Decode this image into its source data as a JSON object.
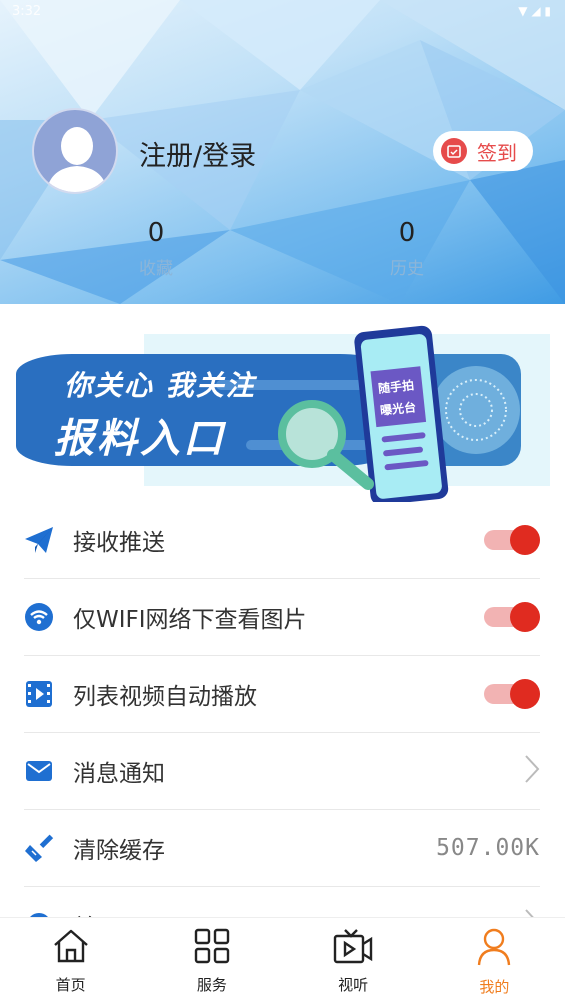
{
  "status_bar": {
    "time": "3:32",
    "battery": ""
  },
  "profile": {
    "login_label": "注册/登录",
    "signin_label": "签到",
    "stats": [
      {
        "value": "0",
        "label": "收藏"
      },
      {
        "value": "0",
        "label": "历史"
      }
    ]
  },
  "banner": {
    "line1": "你关心 我关注",
    "line2": "报料入口",
    "phone_text1": "随手拍",
    "phone_text2": "曝光台"
  },
  "settings": [
    {
      "label": "接收推送",
      "type": "toggle",
      "on": true
    },
    {
      "label": "仅WIFI网络下查看图片",
      "type": "toggle",
      "on": true
    },
    {
      "label": "列表视频自动播放",
      "type": "toggle",
      "on": true
    },
    {
      "label": "消息通知",
      "type": "arrow"
    },
    {
      "label": "清除缓存",
      "type": "value",
      "value": "507.00K"
    },
    {
      "label": "关于",
      "type": "arrow"
    }
  ],
  "nav": [
    {
      "label": "首页",
      "icon": "home-icon"
    },
    {
      "label": "服务",
      "icon": "grid-icon"
    },
    {
      "label": "视听",
      "icon": "tv-icon"
    },
    {
      "label": "我的",
      "icon": "user-icon",
      "active": true
    }
  ],
  "colors": {
    "accent": "#e02b20",
    "nav_active": "#f07d1e",
    "icon_blue": "#1f6fd1"
  }
}
